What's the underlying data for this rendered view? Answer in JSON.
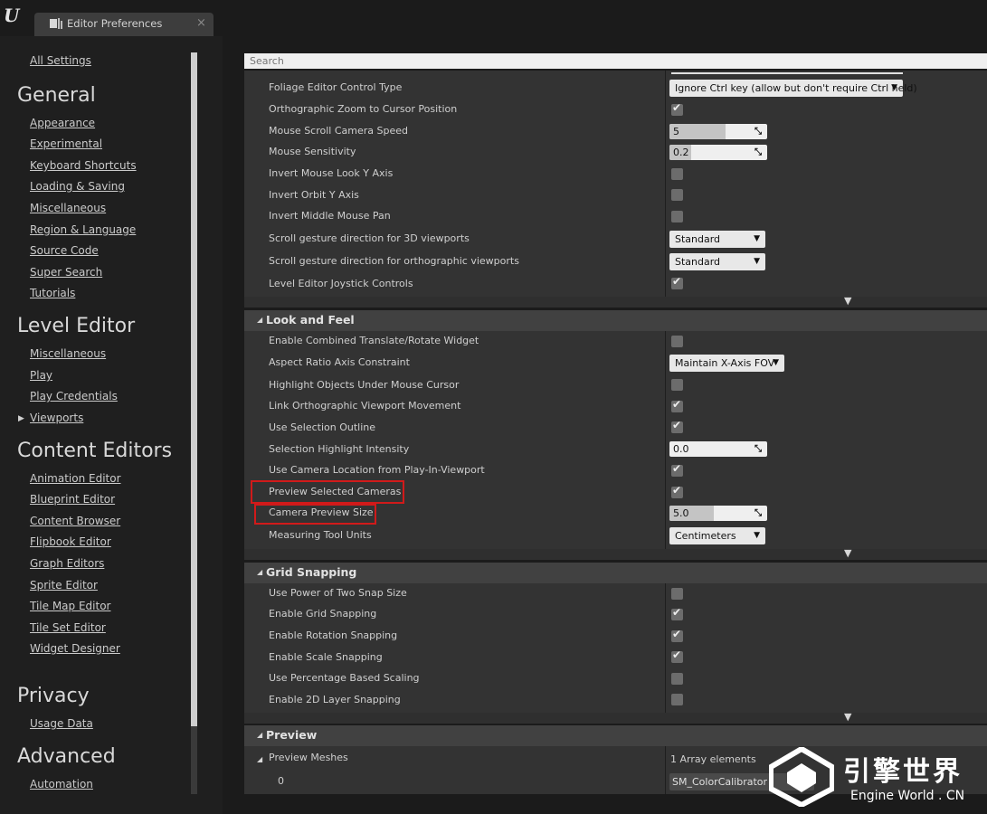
{
  "tab": {
    "title": "Editor Preferences",
    "close": "×"
  },
  "search": {
    "placeholder": "Search"
  },
  "sidebar": {
    "all_settings": "All Settings",
    "general": {
      "heading": "General",
      "items": [
        "Appearance",
        "Experimental",
        "Keyboard Shortcuts",
        "Loading & Saving",
        "Miscellaneous",
        "Region & Language",
        "Source Code",
        "Super Search",
        "Tutorials"
      ]
    },
    "level_editor": {
      "heading": "Level Editor",
      "items": [
        "Miscellaneous",
        "Play",
        "Play Credentials",
        "Viewports"
      ]
    },
    "content_editors": {
      "heading": "Content Editors",
      "items": [
        "Animation Editor",
        "Blueprint Editor",
        "Content Browser",
        "Flipbook Editor",
        "Graph Editors",
        "Sprite Editor",
        "Tile Map Editor",
        "Tile Set Editor",
        "Widget Designer"
      ]
    },
    "privacy": {
      "heading": "Privacy",
      "items": [
        "Usage Data"
      ]
    },
    "advanced": {
      "heading": "Advanced",
      "items": [
        "Automation"
      ]
    }
  },
  "controls": {
    "foliage": "Foliage Editor Control Type",
    "foliage_value": "Ignore Ctrl key (allow but don't require Ctrl held)",
    "ortho_zoom": "Orthographic Zoom to Cursor Position",
    "scroll_speed": "Mouse Scroll Camera Speed",
    "scroll_speed_value": "5",
    "scroll_speed_fill": 0.57,
    "sensitivity": "Mouse Sensitivity",
    "sensitivity_value": "0.2",
    "sensitivity_fill": 0.22,
    "invert_look": "Invert Mouse Look Y Axis",
    "invert_orbit": "Invert Orbit Y Axis",
    "invert_pan": "Invert Middle Mouse Pan",
    "scroll_3d": "Scroll gesture direction for 3D viewports",
    "scroll_3d_value": "Standard",
    "scroll_ortho": "Scroll gesture direction for orthographic viewports",
    "scroll_ortho_value": "Standard",
    "joystick": "Level Editor Joystick Controls"
  },
  "look_and_feel": {
    "header": "Look and Feel",
    "combined_widget": "Enable Combined Translate/Rotate Widget",
    "aspect_ratio": "Aspect Ratio Axis Constraint",
    "aspect_ratio_value": "Maintain X-Axis FOV",
    "highlight_objects": "Highlight Objects Under Mouse Cursor",
    "link_ortho": "Link Orthographic Viewport Movement",
    "selection_outline": "Use Selection Outline",
    "highlight_intensity": "Selection Highlight Intensity",
    "highlight_intensity_value": "0.0",
    "camera_location": "Use Camera Location from Play-In-Viewport",
    "preview_cameras": "Preview Selected Cameras",
    "camera_preview_size": "Camera Preview Size",
    "camera_preview_size_value": "5.0",
    "camera_preview_size_fill": 0.45,
    "measuring_units": "Measuring Tool Units",
    "measuring_units_value": "Centimeters"
  },
  "grid_snapping": {
    "header": "Grid Snapping",
    "power_of_two": "Use Power of Two Snap Size",
    "grid": "Enable Grid Snapping",
    "rotation": "Enable Rotation Snapping",
    "scale": "Enable Scale Snapping",
    "percentage": "Use Percentage Based Scaling",
    "layer_2d": "Enable 2D Layer Snapping"
  },
  "preview": {
    "header": "Preview",
    "meshes": "Preview Meshes",
    "array_elements": "1 Array elements",
    "index": "0",
    "mesh_value": "SM_ColorCalibrator"
  },
  "watermark": {
    "cn": "引擎世界",
    "en": "Engine World . CN"
  },
  "colors": {
    "highlight_box": "#d11a1a",
    "panel_bg": "#333333",
    "header_bg": "#414141"
  }
}
